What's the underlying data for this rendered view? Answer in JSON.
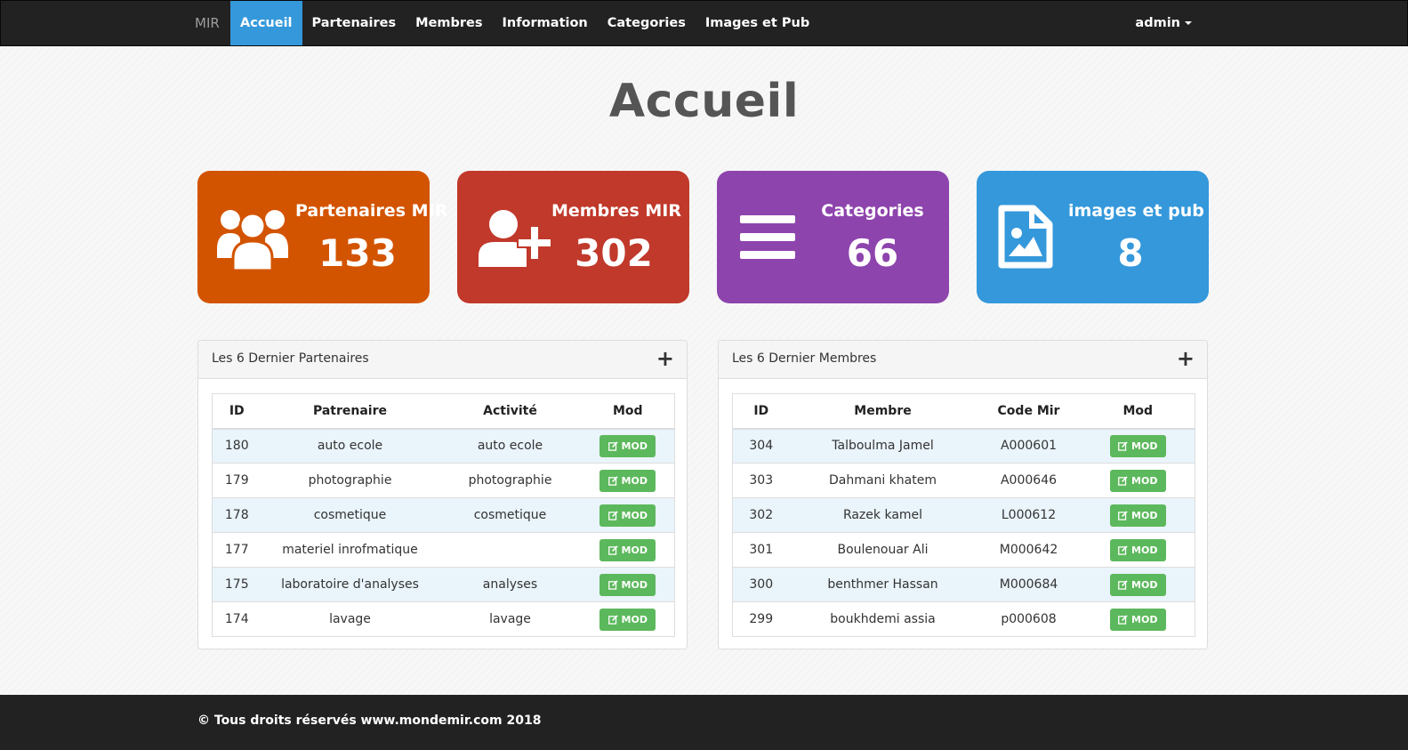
{
  "navbar": {
    "brand": "MIR",
    "items": [
      {
        "label": "Accueil",
        "active": true
      },
      {
        "label": "Partenaires"
      },
      {
        "label": "Membres"
      },
      {
        "label": "Information"
      },
      {
        "label": "Categories"
      },
      {
        "label": "Images et Pub"
      }
    ],
    "user": "admin"
  },
  "page_title": "Accueil",
  "stats": [
    {
      "label": "Partenaires MIR",
      "value": "133",
      "color": "#d35400",
      "icon": "users-group-icon"
    },
    {
      "label": "Membres MIR",
      "value": "302",
      "color": "#c0392b",
      "icon": "user-plus-icon"
    },
    {
      "label": "Categories",
      "value": "66",
      "color": "#8e44ad",
      "icon": "list-bars-icon"
    },
    {
      "label": "images et pub",
      "value": "8",
      "color": "#3498db",
      "icon": "image-file-icon"
    }
  ],
  "partners_panel": {
    "title": "Les 6 Dernier Partenaires",
    "headers": [
      "ID",
      "Patrenaire",
      "Activité",
      "Mod"
    ],
    "mod_label": "MOD",
    "rows": [
      [
        "180",
        "auto ecole",
        "auto ecole"
      ],
      [
        "179",
        "photographie",
        "photographie"
      ],
      [
        "178",
        "cosmetique",
        "cosmetique"
      ],
      [
        "177",
        "materiel inrofmatique",
        ""
      ],
      [
        "175",
        "laboratoire d'analyses",
        "analyses"
      ],
      [
        "174",
        "lavage",
        "lavage"
      ]
    ]
  },
  "members_panel": {
    "title": "Les 6 Dernier Membres",
    "headers": [
      "ID",
      "Membre",
      "Code Mir",
      "Mod"
    ],
    "mod_label": "MOD",
    "rows": [
      [
        "304",
        "Talboulma Jamel",
        "A000601"
      ],
      [
        "303",
        "Dahmani khatem",
        "A000646"
      ],
      [
        "302",
        "Razek kamel",
        "L000612"
      ],
      [
        "301",
        "Boulenouar Ali",
        "M000642"
      ],
      [
        "300",
        "benthmer Hassan",
        "M000684"
      ],
      [
        "299",
        "boukhdemi assia",
        "p000608"
      ]
    ]
  },
  "footer": {
    "text": "© Tous droits réservés www.mondemir.com 2018"
  }
}
